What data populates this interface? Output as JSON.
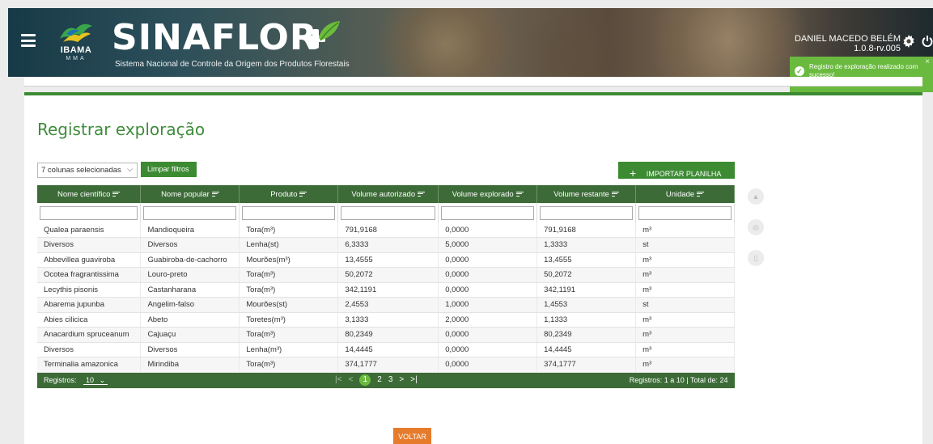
{
  "header": {
    "logo_name": "IBAMA",
    "logo_sub": "MMA",
    "brand": "SINAFLOR",
    "brand_sub": "Sistema Nacional de Controle da Origem dos Produtos Florestais",
    "user_name": "DANIEL MACEDO BELÉM",
    "version": "1.0.8-rv.005"
  },
  "toast": {
    "message": "Registro de exploração realizado com sucesso!",
    "close": "×"
  },
  "page": {
    "title": "Registrar exploração"
  },
  "toolbar": {
    "columns_select": "7 colunas selecionadas",
    "clear_filters": "Limpar filtros",
    "import": "IMPORTAR PLANILHA"
  },
  "table": {
    "columns": [
      "Nome científico",
      "Nome popular",
      "Produto",
      "Volume autorizado",
      "Volume explorado",
      "Volume restante",
      "Unidade"
    ],
    "rows": [
      [
        "Qualea paraensis",
        "Mandioqueira",
        "Tora(m³)",
        "791,9168",
        "0,0000",
        "791,9168",
        "m³"
      ],
      [
        "Diversos",
        "Diversos",
        "Lenha(st)",
        "6,3333",
        "5,0000",
        "1,3333",
        "st"
      ],
      [
        "Abbevillea guaviroba",
        "Guabiroba-de-cachorro",
        "Mourões(m³)",
        "13,4555",
        "0,0000",
        "13,4555",
        "m³"
      ],
      [
        "Ocotea fragrantissima",
        "Louro-preto",
        "Tora(m³)",
        "50,2072",
        "0,0000",
        "50,2072",
        "m³"
      ],
      [
        "Lecythis pisonis",
        "Castanharana",
        "Tora(m³)",
        "342,1191",
        "0,0000",
        "342,1191",
        "m³"
      ],
      [
        "Abarema jupunba",
        "Angelim-falso",
        "Mourões(st)",
        "2,4553",
        "1,0000",
        "1,4553",
        "st"
      ],
      [
        "Abies cilicica",
        "Abeto",
        "Toretes(m³)",
        "3,1333",
        "2,0000",
        "1,1333",
        "m³"
      ],
      [
        "Anacardium spruceanum",
        "Cajuaçu",
        "Tora(m³)",
        "80,2349",
        "0,0000",
        "80,2349",
        "m³"
      ],
      [
        "Diversos",
        "Diversos",
        "Lenha(m³)",
        "14,4445",
        "0,0000",
        "14,4445",
        "m³"
      ],
      [
        "Terminalia amazonica",
        "Mirindiba",
        "Tora(m³)",
        "374,1777",
        "0,0000",
        "374,1777",
        "m³"
      ]
    ]
  },
  "footer": {
    "registros_label": "Registros:",
    "per_page": "10",
    "pages": [
      "1",
      "2",
      "3"
    ],
    "summary": "Registros: 1 a 10 | Total de: 24"
  },
  "actions": {
    "back": "VOLTAR"
  },
  "colors": {
    "primary_green": "#3c8b32",
    "header_green": "#3c6b37",
    "accent_orange": "#e67b2c",
    "toast_green": "#6aba3f"
  }
}
